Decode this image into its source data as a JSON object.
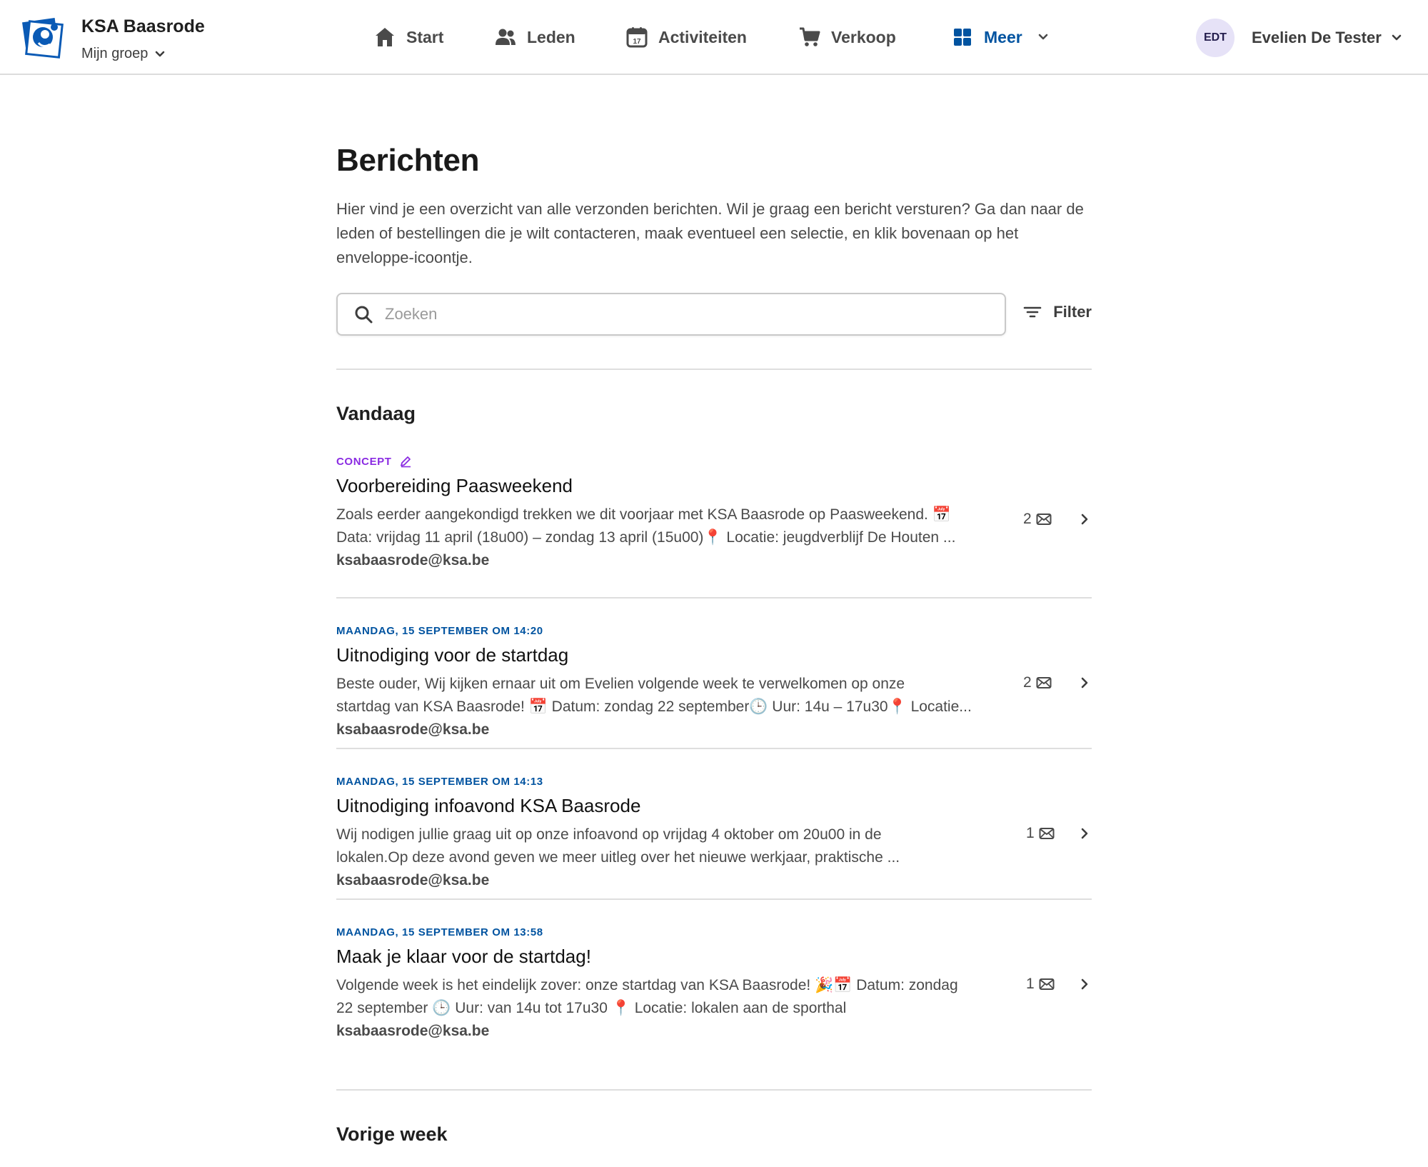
{
  "header": {
    "org_name": "KSA Baasrode",
    "group_label": "Mijn groep",
    "nav": [
      {
        "label": "Start",
        "icon": "home-icon"
      },
      {
        "label": "Leden",
        "icon": "people-icon"
      },
      {
        "label": "Activiteiten",
        "icon": "calendar-icon"
      },
      {
        "label": "Verkoop",
        "icon": "cart-icon"
      },
      {
        "label": "Meer",
        "icon": "grid-icon",
        "active": true
      }
    ],
    "user": {
      "initials": "EDT",
      "name": "Evelien De Tester"
    }
  },
  "page": {
    "title": "Berichten",
    "description": "Hier vind je een overzicht van alle verzonden berichten. Wil je graag een bericht versturen? Ga dan naar de leden of bestellingen die je wilt contacteren, maak eventueel een selectie, en klik bovenaan op het enveloppe-icoontje.",
    "search_placeholder": "Zoeken",
    "filter_label": "Filter"
  },
  "sections": [
    {
      "title": "Vandaag",
      "messages": [
        {
          "meta": "CONCEPT",
          "is_concept": true,
          "title": "Voorbereiding Paasweekend",
          "body_line1": "Zoals eerder aangekondigd trekken we dit voorjaar met KSA Baasrode op Paasweekend. 📅",
          "body_line2": "Data: vrijdag 11 april (18u00) – zondag 13 april (15u00)📍 Locatie: jeugdverblijf De Houten ...",
          "from": "ksabaasrode@ksa.be",
          "count": "2"
        },
        {
          "meta": "MAANDAG, 15 SEPTEMBER OM 14:20",
          "is_concept": false,
          "title": "Uitnodiging voor de startdag",
          "body_line1": "Beste ouder, Wij kijken ernaar uit om Evelien volgende week te verwelkomen op onze",
          "body_line2": "startdag van KSA Baasrode! 📅 Datum: zondag 22 september🕒 Uur: 14u – 17u30📍 Locatie...",
          "from": "ksabaasrode@ksa.be",
          "count": "2"
        },
        {
          "meta": "MAANDAG, 15 SEPTEMBER OM 14:13",
          "is_concept": false,
          "title": "Uitnodiging infoavond KSA Baasrode",
          "body_line1": "Wij nodigen jullie graag uit op onze infoavond op vrijdag 4 oktober om 20u00 in de",
          "body_line2": "lokalen.Op deze avond geven we meer uitleg over het nieuwe werkjaar, praktische ...",
          "from": "ksabaasrode@ksa.be",
          "count": "1"
        },
        {
          "meta": "MAANDAG, 15 SEPTEMBER OM 13:58",
          "is_concept": false,
          "title": "Maak je klaar voor de startdag!",
          "body_line1": "Volgende week is het eindelijk zover: onze startdag van KSA Baasrode! 🎉📅 Datum: zondag",
          "body_line2": "22 september 🕒 Uur: van 14u tot 17u30 📍 Locatie: lokalen aan de sporthal",
          "from": "ksabaasrode@ksa.be",
          "count": "1"
        }
      ]
    },
    {
      "title": "Vorige week",
      "messages": []
    }
  ],
  "colors": {
    "accent": "#0053a0",
    "concept": "#8a2be2",
    "avatar_bg": "#e6e2f7"
  }
}
